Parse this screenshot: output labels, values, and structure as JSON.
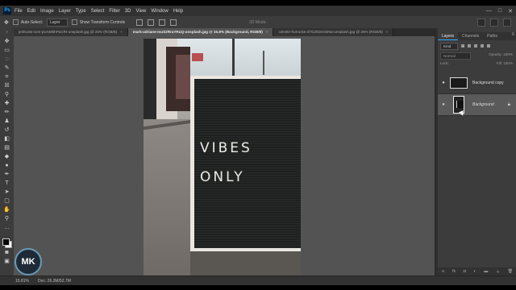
{
  "menubar": {
    "logo": "Ps",
    "items": [
      "File",
      "Edit",
      "Image",
      "Layer",
      "Type",
      "Select",
      "Filter",
      "3D",
      "View",
      "Window",
      "Help"
    ],
    "controls": [
      "—",
      "□",
      "✕"
    ]
  },
  "options": {
    "auto_select": "Auto-Select:",
    "auto_select_target": "Layer",
    "show_transform": "Show Transform Controls",
    "mode_3d": "3D Mode:"
  },
  "tabs": [
    {
      "label": "jeshoots-com-pUAM5hPaCRI-unsplash.jpg @ 25% (RGB/8)",
      "active": false
    },
    {
      "label": "mark-adriane-muS2RraYRuQ-unsplash.jpg @ 15.8% (Background, RGB/8)",
      "active": true
    },
    {
      "label": "celeste-horrocks-d7G2hDmrSNw-unsplash.jpg @ 25% (RGB/8)",
      "active": false
    }
  ],
  "canvas": {
    "board_line1": "VIBES",
    "board_line2": "ONLY"
  },
  "panels": {
    "tabs": [
      "Layers",
      "Channels",
      "Paths"
    ],
    "kind": "Kind",
    "blend_mode": "Normal",
    "opacity": "Opacity: 100%",
    "lock": "Lock:",
    "fill": "Fill: 100%",
    "layers": [
      {
        "name": "Background copy",
        "selected": false
      },
      {
        "name": "Background",
        "selected": true
      }
    ]
  },
  "status": {
    "zoom": "15.81%",
    "doc": "Doc: 26.3M/52.7M"
  },
  "badge": {
    "text": "MK"
  },
  "colors": {
    "accent": "#31a8ff",
    "ui_dark": "#323232",
    "ui_mid": "#3c3c3c",
    "canvas_bg": "#535353"
  }
}
